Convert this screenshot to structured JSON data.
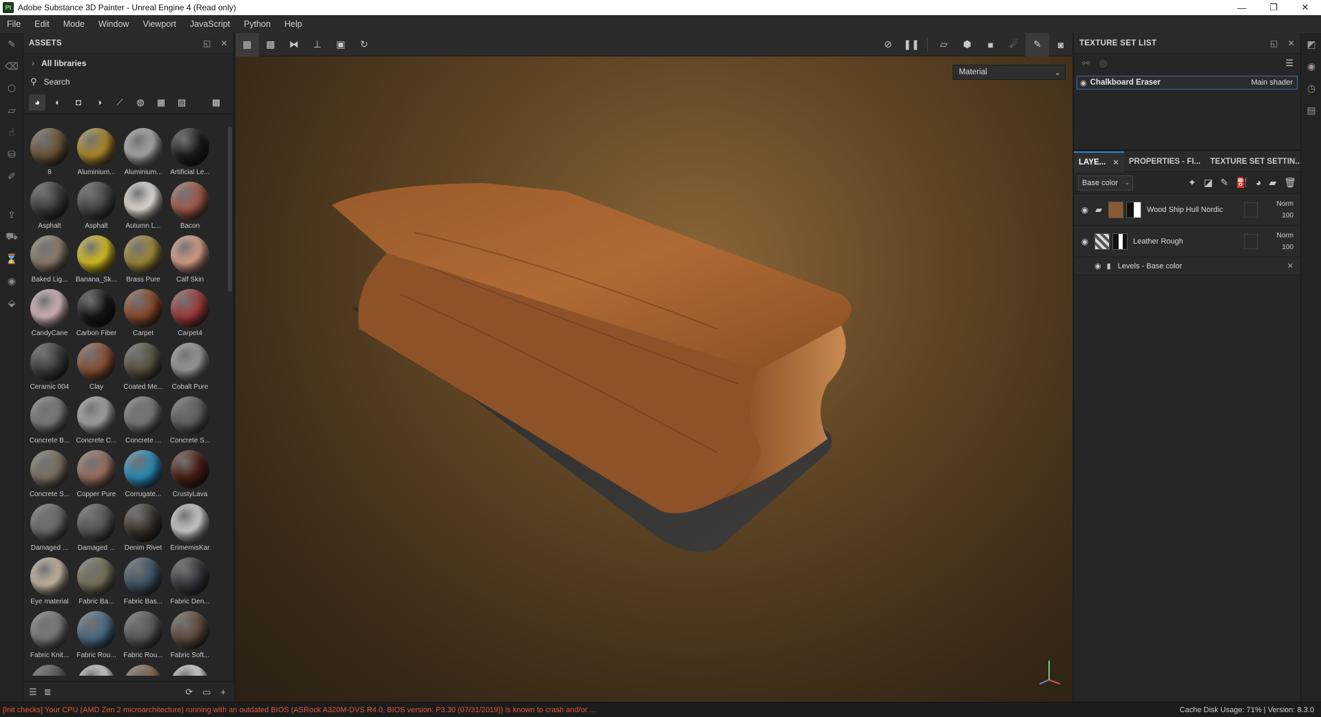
{
  "window": {
    "title": "Adobe Substance 3D Painter - Unreal Engine 4 (Read only)",
    "app_icon": "Pt",
    "controls": [
      "—",
      "❐",
      "✕"
    ]
  },
  "menu": [
    "File",
    "Edit",
    "Mode",
    "Window",
    "Viewport",
    "JavaScript",
    "Python",
    "Help"
  ],
  "assets": {
    "title": "ASSETS",
    "libraries_label": "All libraries",
    "search_placeholder": "Search",
    "items": [
      {
        "label": "8",
        "color": "#6b5439"
      },
      {
        "label": "Aluminium...",
        "color": "#b08a2a"
      },
      {
        "label": "Aluminium...",
        "color": "#a9a9a9"
      },
      {
        "label": "Artificial Le...",
        "color": "#1c1c1c"
      },
      {
        "label": "Asphalt",
        "color": "#3a3a3a"
      },
      {
        "label": "Asphalt",
        "color": "#454545"
      },
      {
        "label": "Autumn L...",
        "color": "#e8e0d8"
      },
      {
        "label": "Bacon",
        "color": "#a45a4a"
      },
      {
        "label": "Baked Lig...",
        "color": "#8b7d6b"
      },
      {
        "label": "Banana_Sk...",
        "color": "#d8c020"
      },
      {
        "label": "Brass Pure",
        "color": "#a08838"
      },
      {
        "label": "Calf Skin",
        "color": "#d9a088"
      },
      {
        "label": "CandyCane",
        "color": "#d8b8b8"
      },
      {
        "label": "Carbon Fiber",
        "color": "#151515"
      },
      {
        "label": "Carpet",
        "color": "#8a4a2a"
      },
      {
        "label": "Carpet4",
        "color": "#a03a3a"
      },
      {
        "label": "Ceramic 004",
        "color": "#3b3b3b"
      },
      {
        "label": "Clay",
        "color": "#8a4e32"
      },
      {
        "label": "Coated Me...",
        "color": "#58503e"
      },
      {
        "label": "Cobalt Pure",
        "color": "#9a9a9a"
      },
      {
        "label": "Concrete B...",
        "color": "#7a7a76"
      },
      {
        "label": "Concrete C...",
        "color": "#a4a4a4"
      },
      {
        "label": "Concrete ...",
        "color": "#777777"
      },
      {
        "label": "Concrete S...",
        "color": "#5e5e5e"
      },
      {
        "label": "Concrete S...",
        "color": "#7d7262"
      },
      {
        "label": "Copper Pure",
        "color": "#9a7060"
      },
      {
        "label": "Corrugate...",
        "color": "#2a8ab8"
      },
      {
        "label": "CrustyLava",
        "color": "#4a1c14"
      },
      {
        "label": "Damaged ...",
        "color": "#6a6a6a"
      },
      {
        "label": "Damaged ...",
        "color": "#555555"
      },
      {
        "label": "Denim Rivet",
        "color": "#3a3028"
      },
      {
        "label": "ErimemisKar",
        "color": "#cfcfcf"
      },
      {
        "label": "Eye material",
        "color": "#c8b8a0"
      },
      {
        "label": "Fabric Ba...",
        "color": "#767056"
      },
      {
        "label": "Fabric Bas...",
        "color": "#3c5264"
      },
      {
        "label": "Fabric Den...",
        "color": "#34383e"
      },
      {
        "label": "Fabric Knit...",
        "color": "#7a7a7a"
      },
      {
        "label": "Fabric Rou...",
        "color": "#4a6a84"
      },
      {
        "label": "Fabric Rou...",
        "color": "#585858"
      },
      {
        "label": "Fabric Soft...",
        "color": "#5e4a3e"
      },
      {
        "label": "",
        "color": "#555555"
      },
      {
        "label": "",
        "color": "#d0d0d0"
      },
      {
        "label": "",
        "color": "#8a6a4a"
      },
      {
        "label": "",
        "color": "#d8d8d8"
      }
    ]
  },
  "viewport": {
    "material_mode": "Material"
  },
  "texture_set_list": {
    "title": "TEXTURE SET LIST",
    "set_name": "Chalkboard Eraser",
    "shader": "Main shader"
  },
  "layers": {
    "tabs": [
      {
        "label": "LAYE..."
      },
      {
        "label": "PROPERTIES - FI..."
      },
      {
        "label": "TEXTURE SET SETTIN..."
      }
    ],
    "channel": "Base color",
    "items": [
      {
        "name": "Wood Ship Hull Nordic",
        "blend": "Norm",
        "opacity": "100"
      },
      {
        "name": "Leather Rough",
        "blend": "Norm",
        "opacity": "100"
      }
    ],
    "effect": "Levels - Base color"
  },
  "status": {
    "warning": "[Init checks] Your CPU (AMD Zen 2 microarchitecture) running with an outdated BIOS (ASRock A320M-DVS R4.0, BIOS version: P3.30 (07/31/2019)) is known to crash and/or ...",
    "cache": "Cache Disk Usage:   71% | Version: 8.3.0"
  }
}
